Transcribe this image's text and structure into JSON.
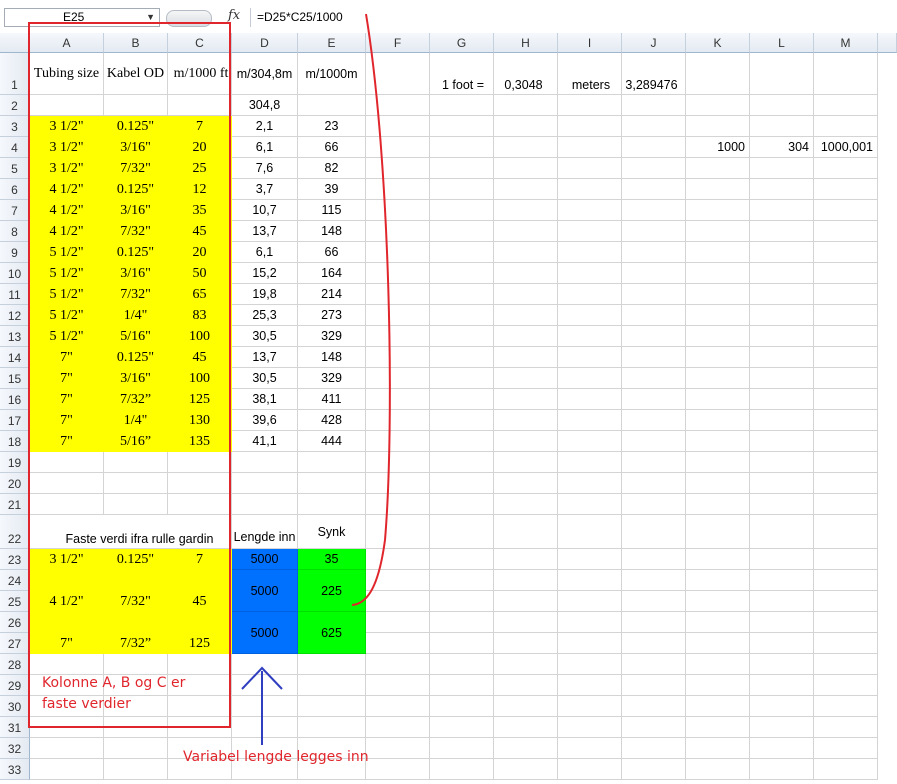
{
  "formula_bar": {
    "cell_ref": "E25",
    "fx_label": "fx",
    "formula": "=D25*C25/1000"
  },
  "columns": [
    "A",
    "B",
    "C",
    "D",
    "E",
    "F",
    "G",
    "H",
    "I",
    "J",
    "K",
    "L",
    "M"
  ],
  "rows": [
    "1",
    "2",
    "3",
    "4",
    "5",
    "6",
    "7",
    "8",
    "9",
    "10",
    "11",
    "12",
    "13",
    "14",
    "15",
    "16",
    "17",
    "18",
    "19",
    "20",
    "21",
    "22",
    "23",
    "24",
    "25",
    "26",
    "27",
    "28",
    "29",
    "30",
    "31",
    "32",
    "33"
  ],
  "header_row": {
    "a": "Tubing size",
    "b": "Kabel OD",
    "c": "m/1000 ft",
    "d": "m/304,8m",
    "e": "m/1000m",
    "g": "1 foot =",
    "h": "0,3048",
    "i": "meters",
    "j": "3,289476"
  },
  "d2": "304,8",
  "table": [
    {
      "a": "3 1/2\"",
      "b": "0.125\"",
      "c": "7",
      "d": "2,1",
      "e": "23"
    },
    {
      "a": "3 1/2\"",
      "b": "3/16\"",
      "c": "20",
      "d": "6,1",
      "e": "66"
    },
    {
      "a": "3 1/2\"",
      "b": "7/32\"",
      "c": "25",
      "d": "7,6",
      "e": "82"
    },
    {
      "a": "4 1/2\"",
      "b": "0.125\"",
      "c": "12",
      "d": "3,7",
      "e": "39"
    },
    {
      "a": "4 1/2\"",
      "b": "3/16\"",
      "c": "35",
      "d": "10,7",
      "e": "115"
    },
    {
      "a": "4 1/2\"",
      "b": "7/32\"",
      "c": "45",
      "d": "13,7",
      "e": "148"
    },
    {
      "a": "5 1/2\"",
      "b": "0.125\"",
      "c": "20",
      "d": "6,1",
      "e": "66"
    },
    {
      "a": "5 1/2\"",
      "b": "3/16\"",
      "c": "50",
      "d": "15,2",
      "e": "164"
    },
    {
      "a": "5 1/2\"",
      "b": "7/32\"",
      "c": "65",
      "d": "19,8",
      "e": "214"
    },
    {
      "a": "5 1/2\"",
      "b": "1/4\"",
      "c": "83",
      "d": "25,3",
      "e": "273"
    },
    {
      "a": "5 1/2\"",
      "b": "5/16\"",
      "c": "100",
      "d": "30,5",
      "e": "329"
    },
    {
      "a": "7\"",
      "b": "0.125\"",
      "c": "45",
      "d": "13,7",
      "e": "148"
    },
    {
      "a": "7\"",
      "b": "3/16\"",
      "c": "100",
      "d": "30,5",
      "e": "329"
    },
    {
      "a": "7\"",
      "b": "7/32”",
      "c": "125",
      "d": "38,1",
      "e": "411"
    },
    {
      "a": "7\"",
      "b": "1/4\"",
      "c": "130",
      "d": "39,6",
      "e": "428"
    },
    {
      "a": "7\"",
      "b": "5/16”",
      "c": "135",
      "d": "41,1",
      "e": "444"
    }
  ],
  "k4": "1000",
  "l4": "304",
  "m4": "1000,001",
  "section2": {
    "title": "Faste verdi ifra rulle gardin",
    "lengde_label": "Lengde inn",
    "synk_label": "Synk",
    "rows": [
      {
        "a": "3 1/2\"",
        "b": "0.125\"",
        "c": "7",
        "d": "5000",
        "e": "35"
      },
      {
        "a": "4 1/2\"",
        "b": "7/32\"",
        "c": "45",
        "d": "5000",
        "e": "225"
      },
      {
        "a": "7\"",
        "b": "7/32”",
        "c": "125",
        "d": "5000",
        "e": "625"
      }
    ]
  },
  "annotations": {
    "box_note_line1": "Kolonne A, B og C er",
    "box_note_line2": "faste verdier",
    "arrow_note": "Variabel lengde legges inn"
  },
  "colors": {
    "yellow_fill": "#ffff00",
    "blue_fill": "#0070ff",
    "green_fill": "#00ff00",
    "annotation_red": "#e0262c",
    "arrow_blue": "#2f3fbf"
  }
}
